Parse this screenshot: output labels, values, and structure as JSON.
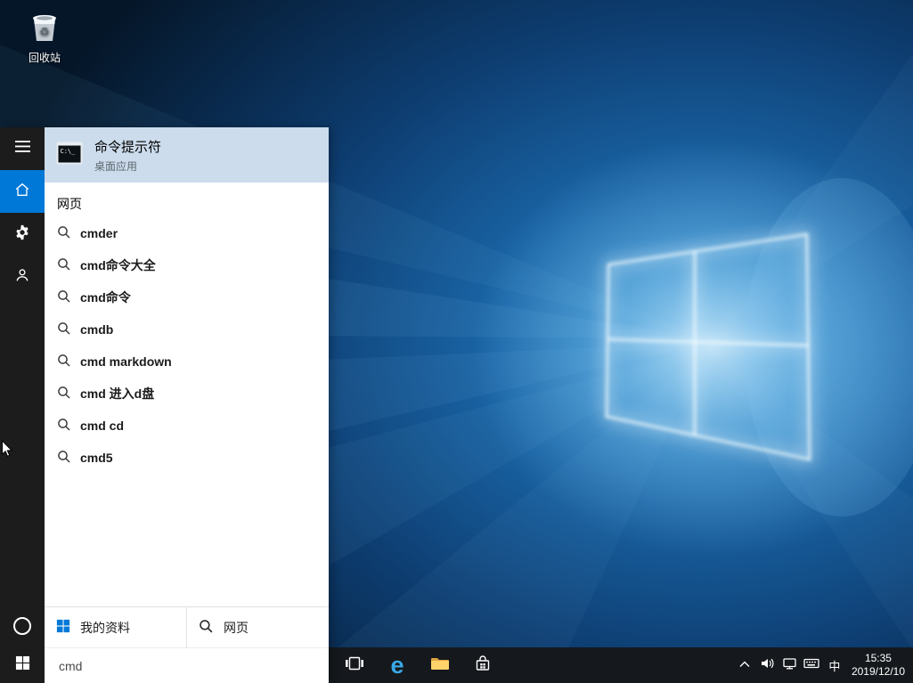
{
  "desktop": {
    "recycle_bin_label": "回收站"
  },
  "search_panel": {
    "top_result": {
      "title": "命令提示符",
      "subtitle": "桌面应用",
      "icon_text": "C:\\_"
    },
    "section_header": "网页",
    "suggestions": [
      "cmder",
      "cmd命令大全",
      "cmd命令",
      "cmdb",
      "cmd markdown",
      "cmd 进入d盘",
      "cmd cd",
      "cmd5"
    ],
    "footer": {
      "my_stuff": "我的资料",
      "web": "网页"
    },
    "search_input": {
      "value": "cmd"
    }
  },
  "taskbar": {
    "edge_glyph": "e",
    "ime_indicator": "中",
    "clock": {
      "time": "15:35",
      "date": "2019/12/10"
    }
  },
  "colors": {
    "accent": "#0078d7",
    "top_result_highlight": "#ccdcec",
    "taskbar_background": "#15181c",
    "sidebar_background": "#1c1c1c"
  }
}
